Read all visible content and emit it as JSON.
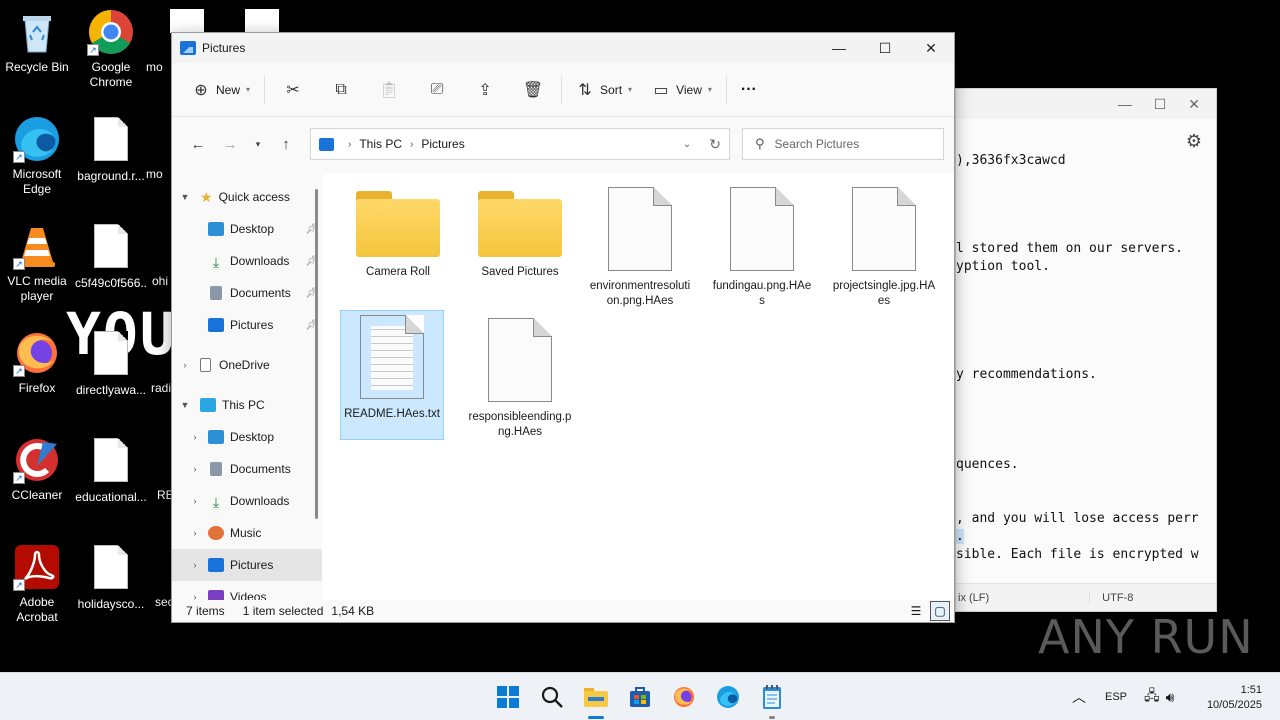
{
  "desktop": {
    "icons": [
      {
        "label": "Recycle Bin"
      },
      {
        "label": "Google Chrome"
      },
      {
        "label": "mo"
      },
      {
        "label": "Microsoft Edge"
      },
      {
        "label": "baground.r..."
      },
      {
        "label": "mo"
      },
      {
        "label": "VLC media player"
      },
      {
        "label": "c5f49c0f566..."
      },
      {
        "label": "ohi"
      },
      {
        "label": "Firefox"
      },
      {
        "label": "directlyawa..."
      },
      {
        "label": "radi"
      },
      {
        "label": "CCleaner"
      },
      {
        "label": "educational..."
      },
      {
        "label": "RE"
      },
      {
        "label": "Adobe Acrobat"
      },
      {
        "label": "holidaysco..."
      },
      {
        "label": "sec"
      }
    ],
    "overlay_text": "YOU"
  },
  "notepad": {
    "lines": [
      "),3636fx3cawcd",
      "l stored them on our servers.",
      "yption tool.",
      "y recommendations.",
      "quences.",
      ", and you will lose access perr",
      "sible. Each file is encrypted w"
    ],
    "highlight": ".",
    "status_eol": "ix (LF)",
    "status_encoding": "UTF-8"
  },
  "explorer": {
    "title": "Pictures",
    "toolbar": {
      "new_label": "New",
      "sort_label": "Sort",
      "view_label": "View",
      "more_label": "···"
    },
    "address": {
      "crumbs": [
        "This PC",
        "Pictures"
      ],
      "search_placeholder": "Search Pictures"
    },
    "nav": {
      "quick_access": "Quick access",
      "qa_items": [
        "Desktop",
        "Downloads",
        "Documents",
        "Pictures"
      ],
      "onedrive": "OneDrive",
      "this_pc": "This PC",
      "pc_items": [
        "Desktop",
        "Documents",
        "Downloads",
        "Music",
        "Pictures",
        "Videos"
      ]
    },
    "files": [
      {
        "name": "Camera Roll",
        "type": "folder"
      },
      {
        "name": "Saved Pictures",
        "type": "folder"
      },
      {
        "name": "environmentresolution.png.HAes",
        "type": "file"
      },
      {
        "name": "fundingau.png.HAes",
        "type": "file"
      },
      {
        "name": "projectsingle.jpg.HAes",
        "type": "file"
      },
      {
        "name": "README.HAes.txt",
        "type": "text",
        "selected": true
      },
      {
        "name": "responsibleending.png.HAes",
        "type": "file"
      }
    ],
    "status": {
      "item_count": "7 items",
      "selection": "1 item selected",
      "size": "1,54 KB"
    }
  },
  "taskbar": {
    "language": "ESP",
    "time": "1:51",
    "date": "10/05/2025"
  },
  "watermark": "ANY RUN"
}
